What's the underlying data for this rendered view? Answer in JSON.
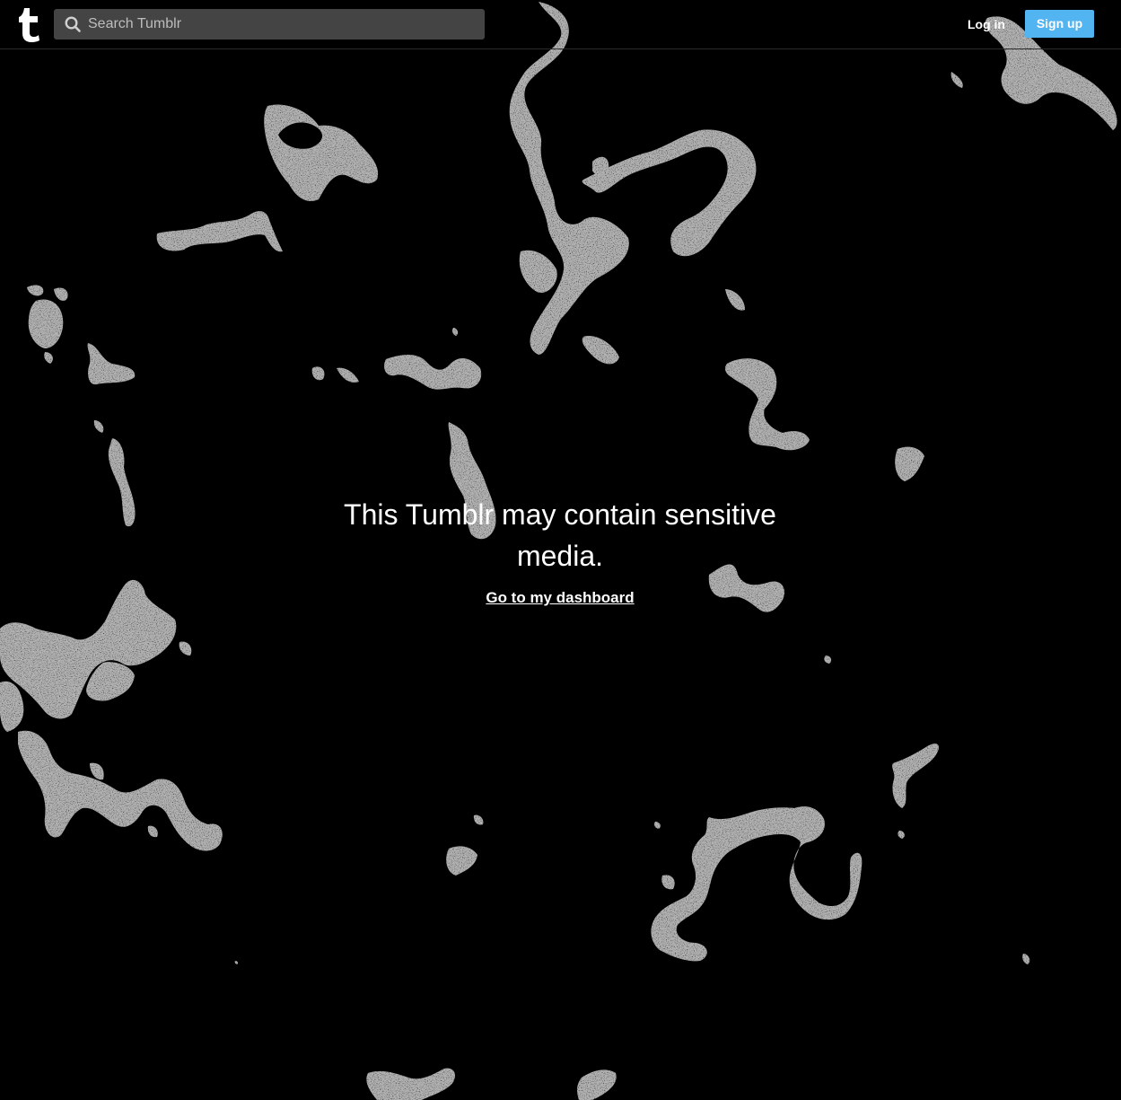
{
  "header": {
    "logo_icon": "tumblr-t-icon",
    "search": {
      "icon": "search-icon",
      "placeholder": "Search Tumblr",
      "value": ""
    },
    "login_label": "Log in",
    "signup_label": "Sign up"
  },
  "main": {
    "warning_title": "This Tumblr may contain sensitive media.",
    "dashboard_link": "Go to my dashboard"
  },
  "colors": {
    "background": "#000000",
    "pattern": "#b3b3b3",
    "search_bg": "#444444",
    "signup_bg": "#52b4f0",
    "text": "#ffffff"
  }
}
